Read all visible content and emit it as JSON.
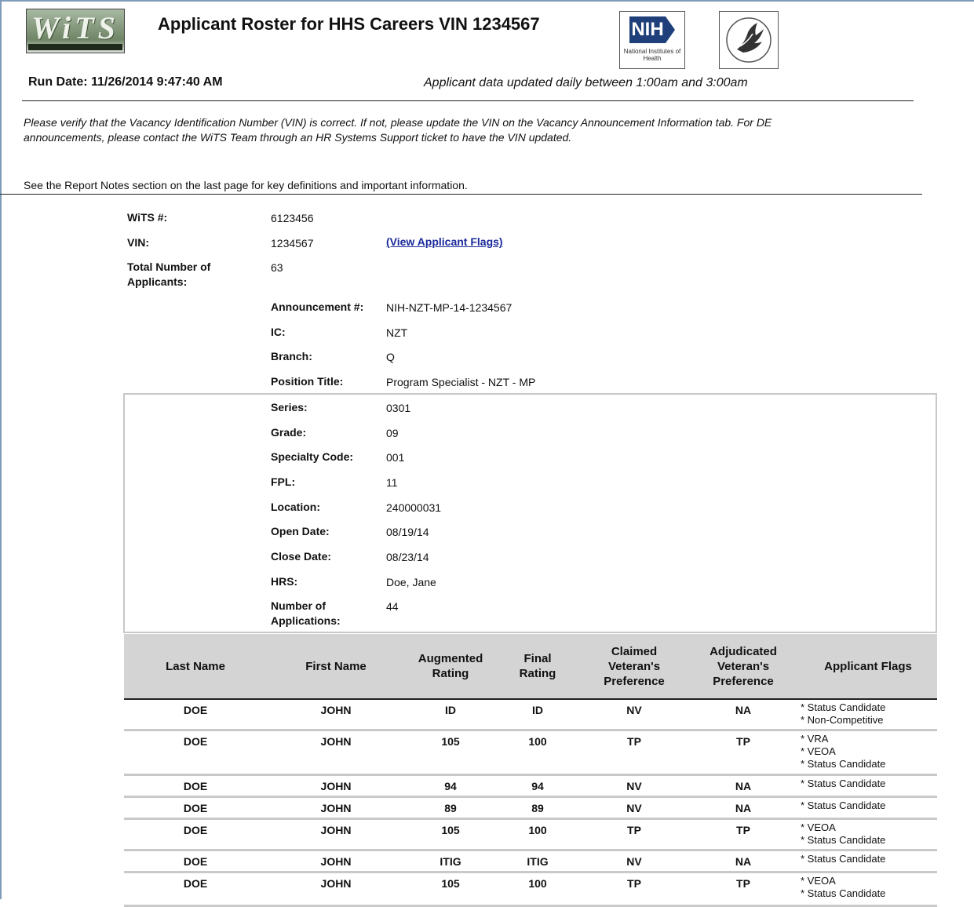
{
  "header": {
    "wits_logo_text": "WiTS",
    "title": "Applicant Roster for HHS Careers VIN 1234567",
    "nih_logo_text": "NIH",
    "nih_logo_sub": "National Institutes of Health",
    "run_date": "Run Date: 11/26/2014 9:47:40 AM",
    "updated_note": "Applicant data updated daily between 1:00am and 3:00am"
  },
  "notes": {
    "verify": "Please verify that the Vacancy Identification Number (VIN) is correct.  If not, please update the VIN on the Vacancy Announcement Information tab.  For DE announcements, please contact the WiTS Team through an HR Systems Support ticket to have the VIN updated.",
    "report_notes": "See the Report Notes section on the last page for key definitions and important information."
  },
  "summary": {
    "wits_label": "WiTS #:",
    "wits_value": "6123456",
    "vin_label": "VIN:",
    "vin_value": "1234567",
    "flags_link": "(View Applicant Flags)",
    "total_label": "Total Number of Applicants:",
    "total_value": "63"
  },
  "details": [
    {
      "label": "Announcement #:",
      "value": "NIH-NZT-MP-14-1234567"
    },
    {
      "label": "IC:",
      "value": "NZT"
    },
    {
      "label": "Branch:",
      "value": "Q"
    },
    {
      "label": "Position Title:",
      "value": "Program Specialist - NZT - MP"
    },
    {
      "label": "Series:",
      "value": "0301"
    },
    {
      "label": "Grade:",
      "value": "09"
    },
    {
      "label": "Specialty Code:",
      "value": "001"
    },
    {
      "label": "FPL:",
      "value": "11"
    },
    {
      "label": "Location:",
      "value": "240000031"
    },
    {
      "label": "Open Date:",
      "value": "08/19/14"
    },
    {
      "label": "Close Date:",
      "value": "08/23/14"
    },
    {
      "label": "HRS:",
      "value": "Doe, Jane"
    },
    {
      "label": "Number of Applications:",
      "value": "44"
    }
  ],
  "table": {
    "columns": [
      "Last Name",
      "First Name",
      "Augmented Rating",
      "Final Rating",
      "Claimed Veteran's Preference",
      "Adjudicated Veteran's Preference",
      "Applicant Flags"
    ],
    "rows": [
      {
        "last": "DOE",
        "first": "JOHN",
        "aug": "ID",
        "final": "ID",
        "claimed": "NV",
        "adj": "NA",
        "flags": [
          "Status Candidate",
          "Non-Competitive"
        ]
      },
      {
        "last": "DOE",
        "first": "JOHN",
        "aug": "105",
        "final": "100",
        "claimed": "TP",
        "adj": "TP",
        "flags": [
          "VRA",
          "VEOA",
          "Status Candidate"
        ]
      },
      {
        "last": "DOE",
        "first": "JOHN",
        "aug": "94",
        "final": "94",
        "claimed": "NV",
        "adj": "NA",
        "flags": [
          "Status Candidate"
        ]
      },
      {
        "last": "DOE",
        "first": "JOHN",
        "aug": "89",
        "final": "89",
        "claimed": "NV",
        "adj": "NA",
        "flags": [
          "Status Candidate"
        ]
      },
      {
        "last": "DOE",
        "first": "JOHN",
        "aug": "105",
        "final": "100",
        "claimed": "TP",
        "adj": "TP",
        "flags": [
          "VEOA",
          "Status Candidate"
        ]
      },
      {
        "last": "DOE",
        "first": "JOHN",
        "aug": "ITIG",
        "final": "ITIG",
        "claimed": "NV",
        "adj": "NA",
        "flags": [
          "Status Candidate"
        ]
      },
      {
        "last": "DOE",
        "first": "JOHN",
        "aug": "105",
        "final": "100",
        "claimed": "TP",
        "adj": "TP",
        "flags": [
          "VEOA",
          "Status Candidate"
        ]
      }
    ]
  }
}
